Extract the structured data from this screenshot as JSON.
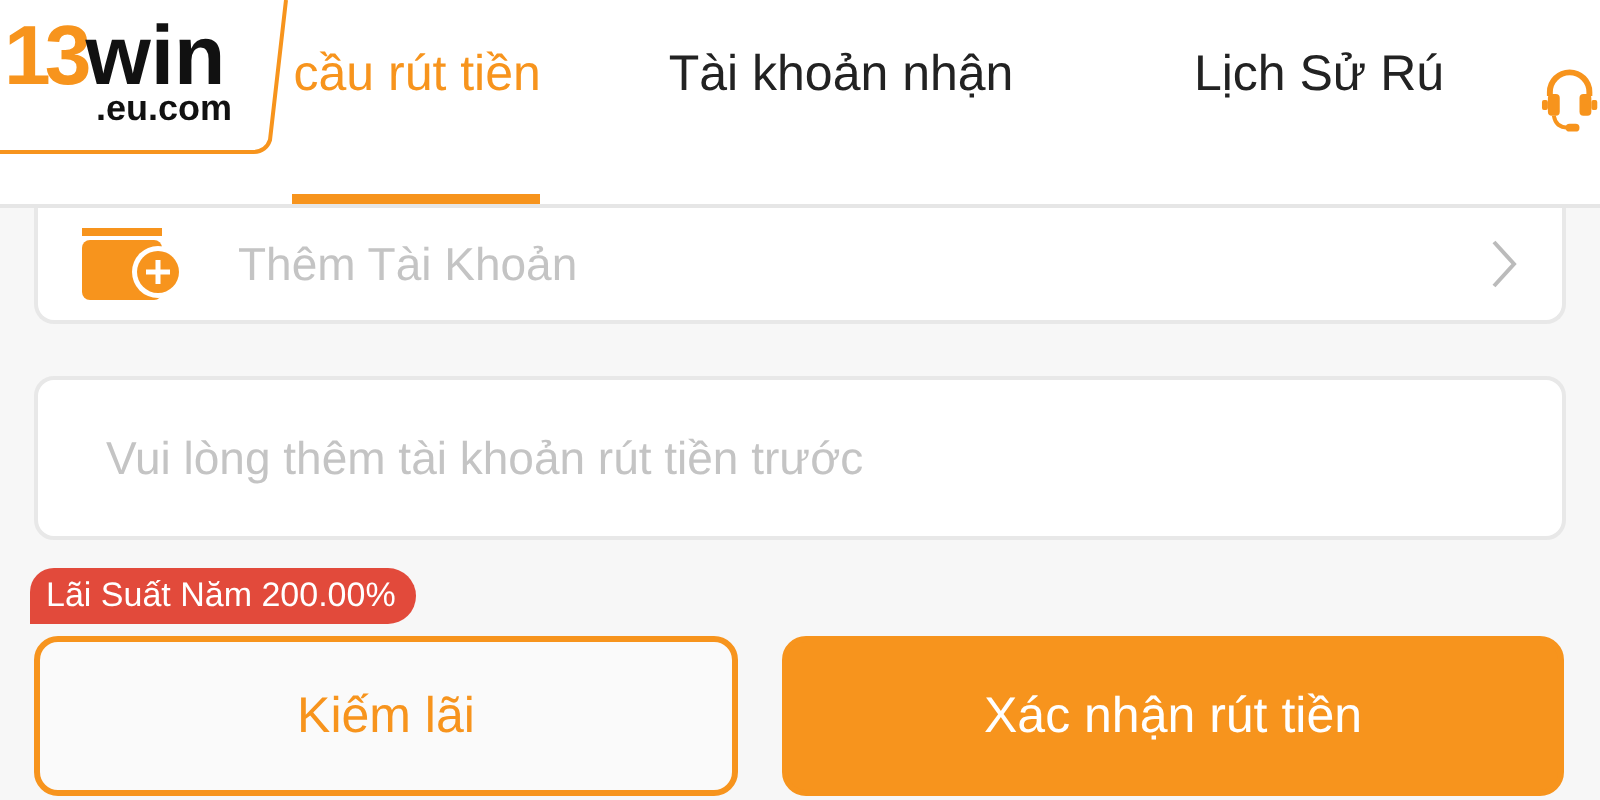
{
  "logo": {
    "number": "13",
    "word": "win",
    "domain": ".eu.com"
  },
  "tabs": [
    {
      "label": "cầu rút tiền",
      "selected": true
    },
    {
      "label": "Tài khoản nhận",
      "selected": false
    },
    {
      "label": "Lịch Sử Rú",
      "selected": false
    }
  ],
  "account_row": {
    "label": "Thêm Tài Khoản"
  },
  "amount_field": {
    "placeholder": "Vui lòng thêm tài khoản rút tiền trước"
  },
  "interest_badge": "Lãi Suất Năm 200.00%",
  "buttons": [
    {
      "label": "Kiếm lãi",
      "kind": "outline"
    },
    {
      "label": "Xác nhận rút tiền",
      "kind": "filled"
    }
  ]
}
